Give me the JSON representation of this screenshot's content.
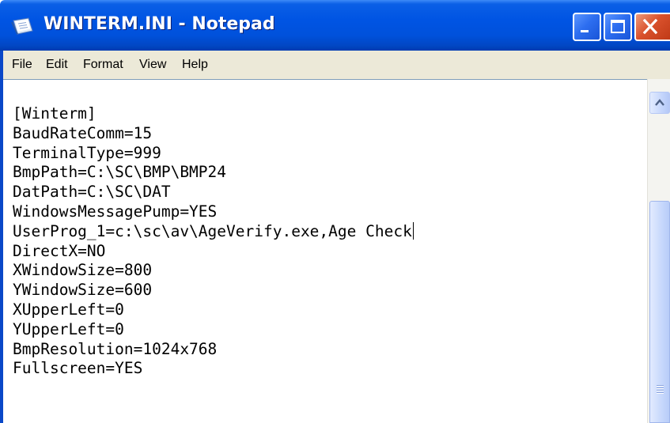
{
  "window": {
    "title": "WINTERM.INI - Notepad"
  },
  "menu": {
    "items": [
      "File",
      "Edit",
      "Format",
      "View",
      "Help"
    ]
  },
  "editor": {
    "lines": [
      "[Winterm]",
      "BaudRateComm=15",
      "TerminalType=999",
      "BmpPath=C:\\SC\\BMP\\BMP24",
      "DatPath=C:\\SC\\DAT",
      "WindowsMessagePump=YES",
      "UserProg_1=c:\\sc\\av\\AgeVerify.exe,Age Check",
      "DirectX=NO",
      "XWindowSize=800",
      "YWindowSize=600",
      "XUpperLeft=0",
      "YUpperLeft=0",
      "BmpResolution=1024x768",
      "Fullscreen=YES"
    ]
  },
  "icons": {
    "app": "notepad-icon",
    "minimize": "minimize-icon",
    "maximize": "maximize-icon",
    "close": "close-icon",
    "scroll_up": "chevron-up-icon"
  },
  "colors": {
    "titlebar": "#0054e3",
    "close_button": "#d9512c",
    "menubar": "#ece9d8",
    "scroll_thumb": "#c7d8fc"
  }
}
